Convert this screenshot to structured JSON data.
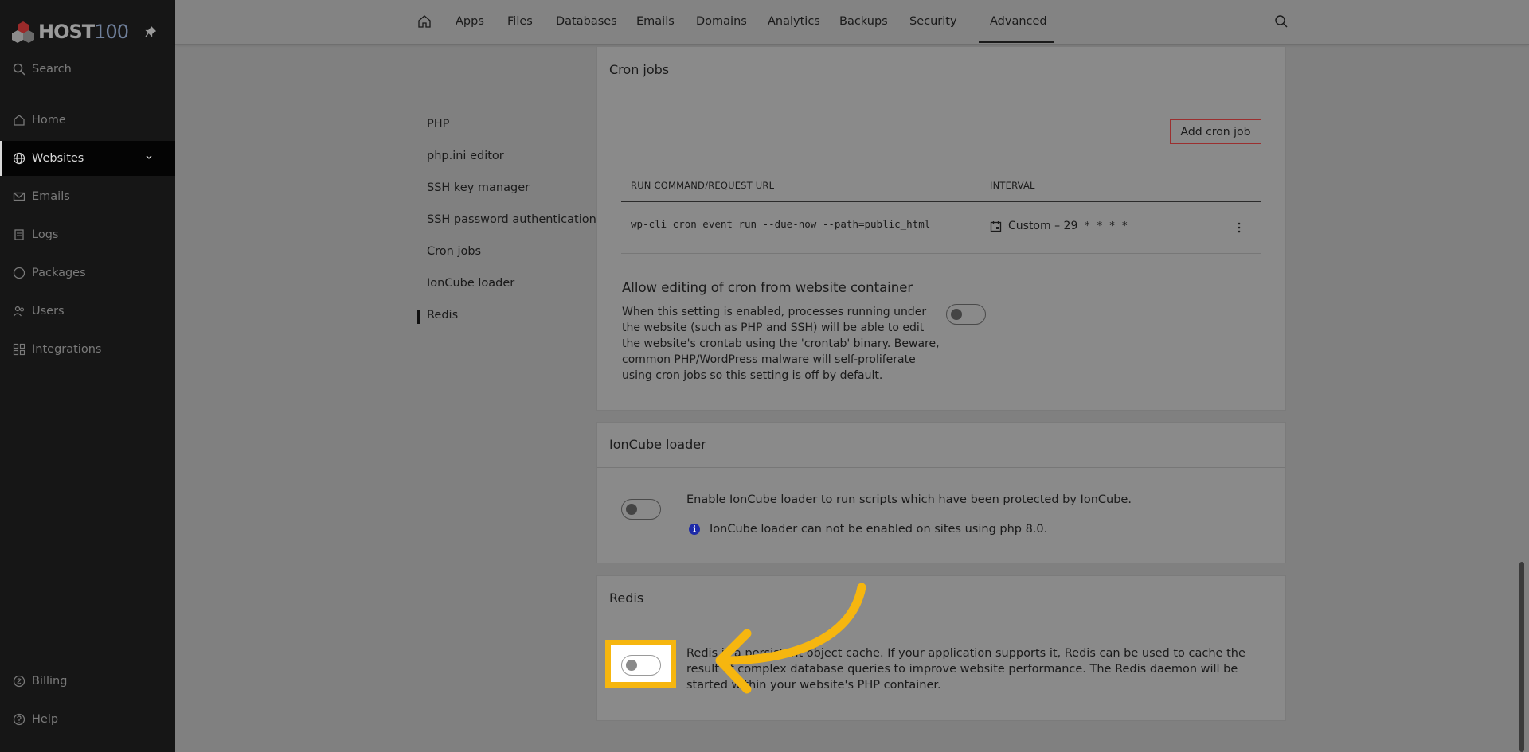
{
  "brand": {
    "name_text": "HOST",
    "name_num": "100"
  },
  "sidebar": {
    "search_label": "Search",
    "items": [
      {
        "label": "Home",
        "icon": "home-icon"
      },
      {
        "label": "Websites",
        "icon": "globe-icon",
        "active": true
      },
      {
        "label": "Emails",
        "icon": "mail-icon"
      },
      {
        "label": "Logs",
        "icon": "logs-icon"
      },
      {
        "label": "Packages",
        "icon": "package-icon"
      },
      {
        "label": "Users",
        "icon": "users-icon"
      },
      {
        "label": "Integrations",
        "icon": "integrations-icon"
      }
    ],
    "bottom": [
      {
        "label": "Billing",
        "icon": "billing-icon"
      },
      {
        "label": "Help",
        "icon": "help-icon"
      }
    ]
  },
  "topnav": {
    "items": [
      "Apps",
      "Files",
      "Databases",
      "Emails",
      "Domains",
      "Analytics",
      "Backups",
      "Security",
      "Advanced"
    ],
    "active": "Advanced"
  },
  "subnav": {
    "items": [
      "PHP",
      "php.ini editor",
      "SSH key manager",
      "SSH password authentication",
      "Cron jobs",
      "IonCube loader",
      "Redis"
    ],
    "active": "Redis"
  },
  "cron": {
    "title": "Cron jobs",
    "add_button": "Add cron job",
    "columns": [
      "RUN COMMAND/REQUEST URL",
      "INTERVAL"
    ],
    "rows": [
      {
        "command": "wp-cli cron event run --due-now --path=public_html",
        "interval_label": "Custom – 29",
        "interval_expr": "* * * *"
      }
    ],
    "edit_setting": {
      "title": "Allow editing of cron from website container",
      "description": "When this setting is enabled, processes running under the website (such as PHP and SSH) will be able to edit the website's crontab using the 'crontab' binary. Beware, common PHP/WordPress malware will self-proliferate using cron jobs so this setting is off by default.",
      "enabled": false
    }
  },
  "ioncube": {
    "title": "IonCube loader",
    "description": "Enable IonCube loader to run scripts which have been protected by IonCube.",
    "info": "IonCube loader can not be enabled on sites using php 8.0.",
    "enabled": false
  },
  "redis": {
    "title": "Redis",
    "description": "Redis is a persistent object cache. If your application supports it, Redis can be used to cache the result of complex database queries to improve website performance. The Redis daemon will be started within your website's PHP container.",
    "enabled": false
  },
  "colors": {
    "highlight": "#f6b60f",
    "accent_border": "#9b2f2f",
    "info": "#1d2aa8"
  }
}
